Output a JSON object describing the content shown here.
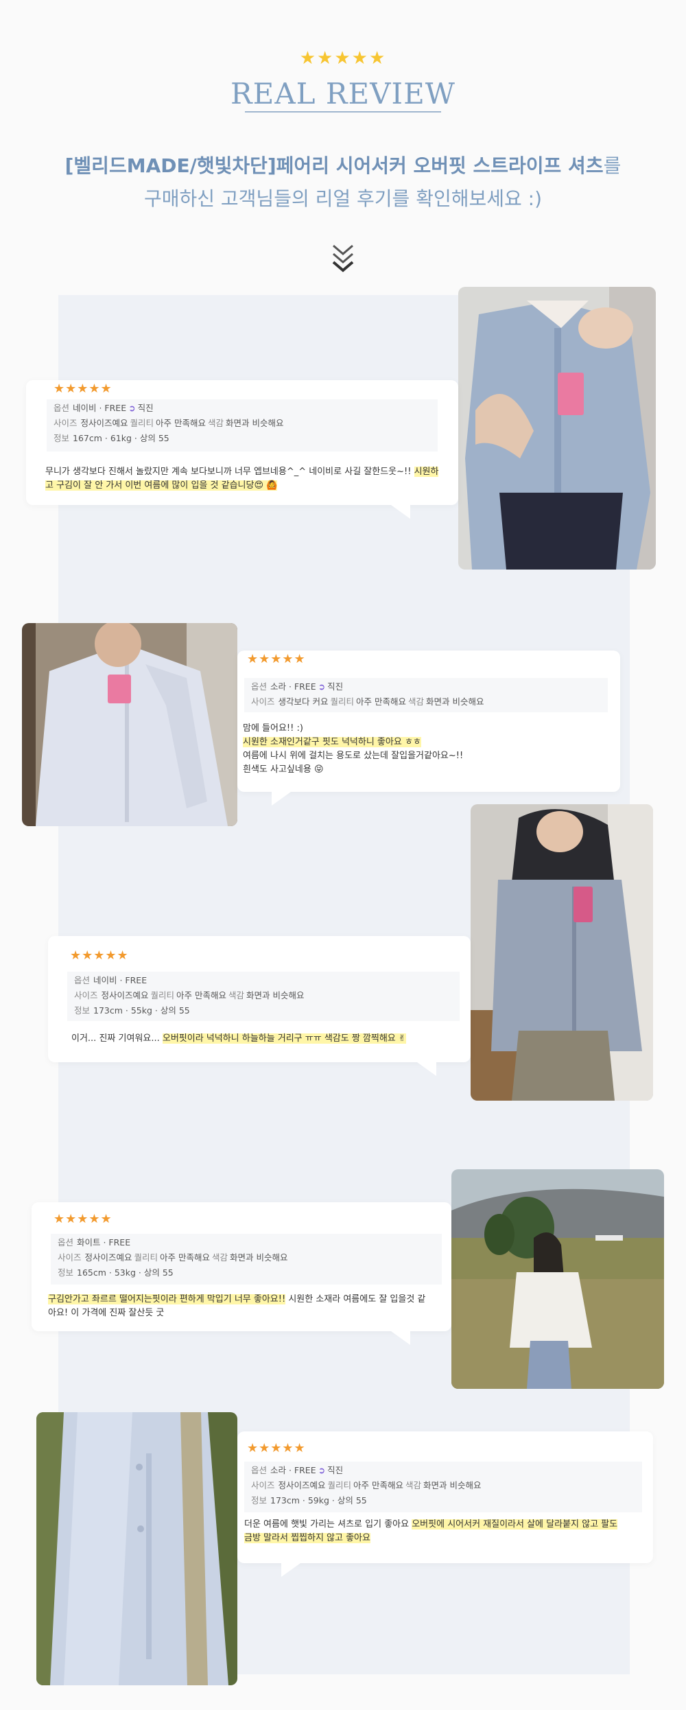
{
  "header": {
    "stars": "★★★★★",
    "title": "REAL REVIEW",
    "product_name": "[벨리드MADE/햇빛차단]페어리 시어서커 오버핏 스트라이프 셔츠",
    "subtitle_suffix": "를",
    "subtitle_line2": "구매하신 고객님들의 리얼 후기를 확인해보세요 :)"
  },
  "colors": {
    "accent": "#7f9fc1",
    "star_top": "#f7c531",
    "star_review": "#f29a2e",
    "highlight": "#fff6a8",
    "panel": "#eef1f6"
  },
  "reviews": [
    {
      "stars": "★★★★★",
      "option_label": "옵션",
      "option_value": "네이비 · FREE",
      "verified": "직진",
      "size_label": "사이즈",
      "size_value": "정사이즈예요",
      "quality_label": "퀄리티",
      "quality_value": "아주 만족해요",
      "color_label": "색감",
      "color_value": "화면과 비슷해요",
      "info_label": "정보",
      "info_value": "167cm · 61kg · 상의 55",
      "text_plain": "무니가 생각보다 진해서 놀랐지만 계속 보다보니까 너무 엡브네용^_^ 네이비로 사길 잘한드웃~!! ",
      "text_hl1": "시원하",
      "text_hl2": "고 구김이 잘 안 가서 이번 여름에 많이 입을 것 같습니당😍 🙆"
    },
    {
      "stars": "★★★★★",
      "option_label": "옵션",
      "option_value": "소라 · FREE",
      "verified": "직진",
      "size_label": "사이즈",
      "size_value": "생각보다 커요",
      "quality_label": "퀄리티",
      "quality_value": "아주 만족해요",
      "color_label": "색감",
      "color_value": "화면과 비슷해요",
      "line1": "맘에 들어요!! :)",
      "line2_hl": "시원한 소재인거같구 핏도 넉넉하니 좋아요 ㅎㅎ",
      "line3": "여름에 나시 위에 걸치는 용도로 샀는데 잘입을거같아요~!!",
      "line4": "흰색도 사고싶네용 😝"
    },
    {
      "stars": "★★★★★",
      "option_label": "옵션",
      "option_value": "네이비 · FREE",
      "size_label": "사이즈",
      "size_value": "정사이즈예요",
      "quality_label": "퀄리티",
      "quality_value": "아주 만족해요",
      "color_label": "색감",
      "color_value": "화면과 비슷해요",
      "info_label": "정보",
      "info_value": "173cm · 55kg · 상의 55",
      "text_plain": "이거... 진짜 기여워요... ",
      "text_hl": "오버핏이라 넉넉하니 하늘하늘 거리구 ㅠㅠ 색감도 짱 깜찍해요 ✌"
    },
    {
      "stars": "★★★★★",
      "option_label": "옵션",
      "option_value": "화이트 · FREE",
      "size_label": "사이즈",
      "size_value": "정사이즈예요",
      "quality_label": "퀄리티",
      "quality_value": "아주 만족해요",
      "color_label": "색감",
      "color_value": "화면과 비슷해요",
      "info_label": "정보",
      "info_value": "165cm · 53kg · 상의 55",
      "text_hl": "구김안가고 좌르르 떨어지는핏이라 편하게 막입기 너무 좋아요!!",
      "text_plain1": " 시원한 소재라 여름에도 잘 입을것 같",
      "text_plain2": "아요! 이 가격에 진짜 잘산듯 굿"
    },
    {
      "stars": "★★★★★",
      "option_label": "옵션",
      "option_value": "소라 · FREE",
      "verified": "직진",
      "size_label": "사이즈",
      "size_value": "정사이즈예요",
      "quality_label": "퀄리티",
      "quality_value": "아주 만족해요",
      "color_label": "색감",
      "color_value": "화면과 비슷해요",
      "info_label": "정보",
      "info_value": "173cm · 59kg · 상의 55",
      "text_plain": "더운 여름에 햇빛 가리는 셔츠로 입기 좋아요 ",
      "text_hl1": "오버핏에 시어서커 재질이라서 살에 달라붙지 않고 팔도",
      "text_hl2": "금방 말라서 찝찝하지 않고 좋아요 "
    }
  ]
}
